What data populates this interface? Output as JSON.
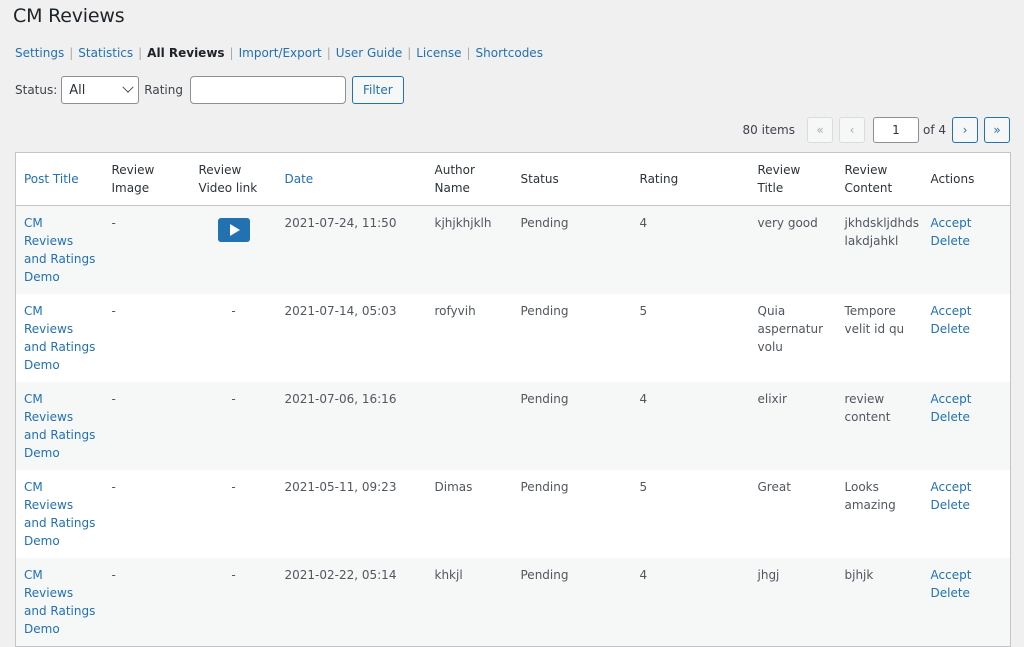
{
  "page_title": "CM Reviews",
  "subnav": [
    {
      "label": "Settings",
      "current": false
    },
    {
      "label": "Statistics",
      "current": false
    },
    {
      "label": "All Reviews",
      "current": true
    },
    {
      "label": "Import/Export",
      "current": false
    },
    {
      "label": "User Guide",
      "current": false
    },
    {
      "label": "License",
      "current": false
    },
    {
      "label": "Shortcodes",
      "current": false
    }
  ],
  "filters": {
    "status_label": "Status:",
    "status_value": "All",
    "rating_label": "Rating",
    "rating_value": "",
    "filter_button": "Filter"
  },
  "pagination": {
    "items_count": "80 items",
    "first": "«",
    "prev": "‹",
    "current_page": "1",
    "of_text": "of 4",
    "next": "›",
    "last": "»"
  },
  "table": {
    "columns": [
      {
        "label": "Post Title",
        "sortable": true
      },
      {
        "label": "Review Image",
        "sortable": false
      },
      {
        "label": "Review Video link",
        "sortable": false
      },
      {
        "label": "Date",
        "sortable": true
      },
      {
        "label": "Author Name",
        "sortable": false
      },
      {
        "label": "Status",
        "sortable": false
      },
      {
        "label": "Rating",
        "sortable": false
      },
      {
        "label": "Review Title",
        "sortable": false
      },
      {
        "label": "Review Content",
        "sortable": false
      },
      {
        "label": "Actions",
        "sortable": false
      }
    ],
    "rows": [
      {
        "post_title": "CM Reviews and Ratings Demo",
        "image": "-",
        "video": "play",
        "date": "2021-07-24, 11:50",
        "author": "kjhjkhjklh",
        "status": "Pending",
        "rating": "4",
        "review_title": "very good",
        "review_content": "jkhdskljdhds lakdjahkl",
        "accept": "Accept",
        "delete": "Delete"
      },
      {
        "post_title": "CM Reviews and Ratings Demo",
        "image": "-",
        "video": "-",
        "date": "2021-07-14, 05:03",
        "author": "rofyvih",
        "status": "Pending",
        "rating": "5",
        "review_title": "Quia aspernatur volu",
        "review_content": "Tempore velit id qu",
        "accept": "Accept",
        "delete": "Delete"
      },
      {
        "post_title": "CM Reviews and Ratings Demo",
        "image": "-",
        "video": "-",
        "date": "2021-07-06, 16:16",
        "author": "",
        "status": "Pending",
        "rating": "4",
        "review_title": "elixir",
        "review_content": "review content",
        "accept": "Accept",
        "delete": "Delete"
      },
      {
        "post_title": "CM Reviews and Ratings Demo",
        "image": "-",
        "video": "-",
        "date": "2021-05-11, 09:23",
        "author": "Dimas",
        "status": "Pending",
        "rating": "5",
        "review_title": "Great",
        "review_content": "Looks amazing",
        "accept": "Accept",
        "delete": "Delete"
      },
      {
        "post_title": "CM Reviews and Ratings Demo",
        "image": "-",
        "video": "-",
        "date": "2021-02-22, 05:14",
        "author": "khkjl",
        "status": "Pending",
        "rating": "4",
        "review_title": "jhgj",
        "review_content": "bjhjk",
        "accept": "Accept",
        "delete": "Delete"
      }
    ]
  },
  "colors": {
    "link": "#2271b1",
    "background": "#f0f0f1",
    "row_alt": "#f6f7f7"
  }
}
